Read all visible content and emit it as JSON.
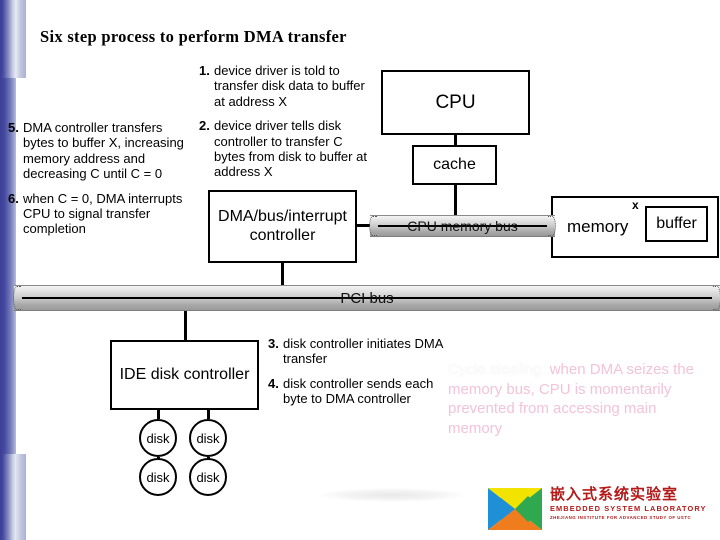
{
  "slide": {
    "title": "Six step process to perform DMA transfer"
  },
  "steps_left": [
    {
      "num": "5.",
      "text": "DMA controller transfers bytes to buffer X, increasing memory address and decreasing C until C = 0"
    },
    {
      "num": "6.",
      "text": "when C = 0, DMA interrupts CPU to signal transfer completion"
    }
  ],
  "steps_top": [
    {
      "num": "1.",
      "text": "device driver is told to transfer disk data to buffer at address X"
    },
    {
      "num": "2.",
      "text": "device driver tells disk controller to transfer C bytes from disk to buffer at address X"
    }
  ],
  "steps_bottom": [
    {
      "num": "3.",
      "text": "disk controller initiates DMA transfer"
    },
    {
      "num": "4.",
      "text": "disk controller sends each byte to DMA controller"
    }
  ],
  "diagram": {
    "cpu": "CPU",
    "cache": "cache",
    "dma_controller": "DMA/bus/interrupt controller",
    "memory": "memory",
    "buffer": "buffer",
    "buffer_address_label": "x",
    "cpu_memory_bus": "CPU memory bus",
    "pci_bus": "PCI bus",
    "ide_controller": "IDE disk controller",
    "disks": [
      "disk",
      "disk",
      "disk",
      "disk"
    ]
  },
  "note": {
    "lead": "Cycle stealing:",
    "body": " when DMA seizes the memory bus, CPU is momentarily prevented from accessing main memory"
  },
  "logo": {
    "chinese": "嵌入式系统实验室",
    "english": "EMBEDDED SYSTEM LABORATORY",
    "subtitle": "ZHEJIANG INSTITUTE FOR ADVANCED STUDY OF USTC"
  },
  "colors": {
    "edge_blue": "#3b3f96",
    "note_pink": "#f3c3d8",
    "logo_red": "#b31a1a",
    "bus_gray": "#c9c9c9"
  }
}
